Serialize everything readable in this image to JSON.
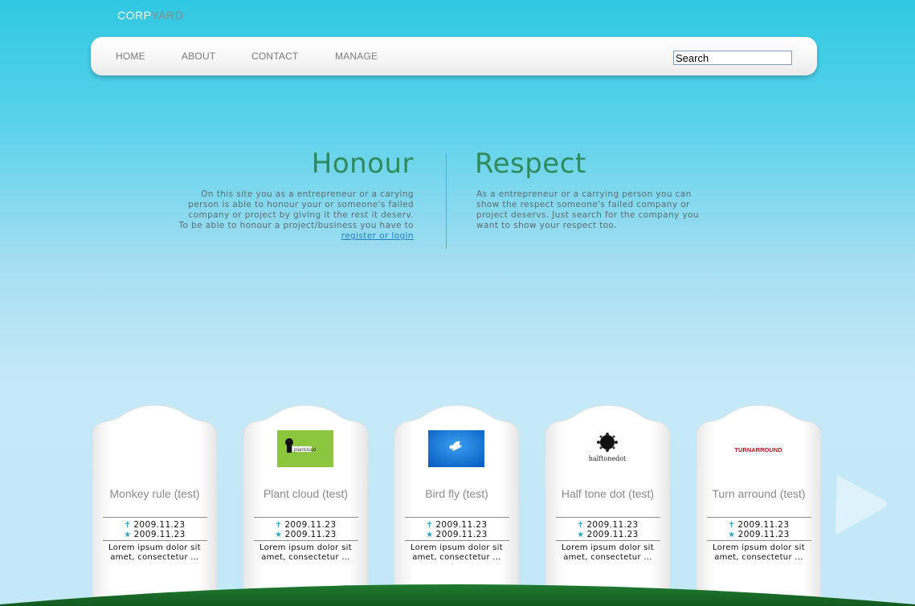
{
  "logo": {
    "part1": "CORP",
    "part2": "YARD"
  },
  "nav": {
    "items": [
      {
        "label": "HOME"
      },
      {
        "label": "ABOUT"
      },
      {
        "label": "CONTACT"
      },
      {
        "label": "MANAGE"
      }
    ],
    "search_value": "Search"
  },
  "honour": {
    "title": "Honour",
    "lines": [
      "On this site you as a entrepreneur or a carying",
      "person is able to honour your or someone's failed",
      "company or project by giving it the rest it deserv.",
      "To be able to honour a project/business you have to"
    ],
    "link": "register or login"
  },
  "respect": {
    "title": "Respect",
    "lines": [
      "As a entrepreneur or a carrying person you can",
      "show the respect someone's failed company or",
      "project deservs. Just search for the company you",
      "want to show your respect too."
    ]
  },
  "cards": [
    {
      "title": "Monkey rule (test)",
      "date1": "2009.11.23",
      "date2": "2009.11.23",
      "desc_line1": "Lorem ipsum dolor sit",
      "desc_line2": "amet, consectetur ...",
      "logo": "none"
    },
    {
      "title": "Plant cloud (test)",
      "date1": "2009.11.23",
      "date2": "2009.11.23",
      "desc_line1": "Lorem ipsum dolor sit",
      "desc_line2": "amet, consectetur ...",
      "logo": "plantcloud",
      "logo_text": "plantcloud"
    },
    {
      "title": "Bird fly (test)",
      "date1": "2009.11.23",
      "date2": "2009.11.23",
      "desc_line1": "Lorem ipsum dolor sit",
      "desc_line2": "amet, consectetur ...",
      "logo": "birdfly"
    },
    {
      "title": "Half tone dot (test)",
      "date1": "2009.11.23",
      "date2": "2009.11.23",
      "desc_line1": "Lorem ipsum dolor sit",
      "desc_line2": "amet, consectetur ...",
      "logo": "halftonedot",
      "logo_text": "halftonedot"
    },
    {
      "title": "Turn arround (test)",
      "date1": "2009.11.23",
      "date2": "2009.11.23",
      "desc_line1": "Lorem ipsum dolor sit",
      "desc_line2": "amet, consectetur ...",
      "logo": "turnarround",
      "logo_text": "TURNARROUND"
    }
  ],
  "icons": {
    "date1_icon": "cross-icon",
    "date2_icon": "star-icon",
    "next": "play-arrow-icon"
  },
  "colors": {
    "sky_top": "#30c8e2",
    "sky_bottom": "#c3e8f7",
    "heading_green": "#2f8a5c",
    "link_blue": "#1d7fc0",
    "hill_green": "#1c6e2a"
  }
}
